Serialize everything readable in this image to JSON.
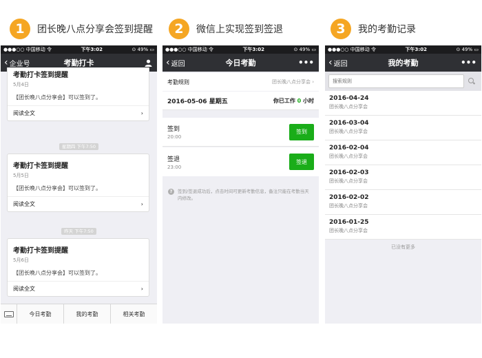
{
  "steps": [
    {
      "num": "1",
      "title": "团长晚八点分享会签到提醒"
    },
    {
      "num": "2",
      "title": "微信上实现签到签退"
    },
    {
      "num": "3",
      "title": "我的考勤记录"
    }
  ],
  "statusbar": {
    "carrier": "●●●○○ 中国移动",
    "wifi": "令",
    "time": "下午3:02",
    "battery": "⊙ 49% ▭"
  },
  "screen1": {
    "nav_back": "企业号",
    "nav_title": "考勤打卡",
    "nav_right_icon": "user-icon",
    "cards": [
      {
        "title": "考勤打卡签到提醒",
        "date": "5月4日",
        "body": "【团长晚八点分享会】可以签到了。",
        "link": "阅读全文"
      },
      {
        "title": "考勤打卡签到提醒",
        "date": "5月5日",
        "body": "【团长晚八点分享会】可以签到了。",
        "link": "阅读全文"
      },
      {
        "title": "考勤打卡签到提醒",
        "date": "5月6日",
        "body": "【团长晚八点分享会】可以签到了。",
        "link": "阅读全文"
      }
    ],
    "time_labels": [
      "星期四 下午7:50",
      "昨天 下午7:50"
    ],
    "tabs": [
      "今日考勤",
      "我的考勤",
      "相关考勤"
    ]
  },
  "screen2": {
    "nav_back": "返回",
    "nav_title": "今日考勤",
    "nav_more": "•••",
    "rule_label": "考勤规则",
    "rule_value": "团长晚八点分享会",
    "date": "2016-05-06 星期五",
    "worked_prefix": "你已工作",
    "worked_value": "0",
    "worked_unit": "小时",
    "signin": {
      "title": "签到",
      "time": "20:00",
      "button": "签到"
    },
    "signout": {
      "title": "签退",
      "time": "23:00",
      "button": "签退"
    },
    "note": "签到/签退成功后，点击时间可更新考勤信息，备注只能在考勤当天内修改。"
  },
  "screen3": {
    "nav_back": "返回",
    "nav_title": "我的考勤",
    "nav_more": "•••",
    "search_placeholder": "搜索规则",
    "records": [
      {
        "date": "2016-04-24",
        "sub": "团长晚八点分享会"
      },
      {
        "date": "2016-03-04",
        "sub": "团长晚八点分享会"
      },
      {
        "date": "2016-02-04",
        "sub": "团长晚八点分享会"
      },
      {
        "date": "2016-02-03",
        "sub": "团长晚八点分享会"
      },
      {
        "date": "2016-02-02",
        "sub": "团长晚八点分享会"
      },
      {
        "date": "2016-01-25",
        "sub": "团长晚八点分享会"
      }
    ],
    "no_more": "已没有更多"
  },
  "colors": {
    "accent": "#f5a623",
    "navbar": "#2f3034",
    "green": "#1aad19"
  }
}
